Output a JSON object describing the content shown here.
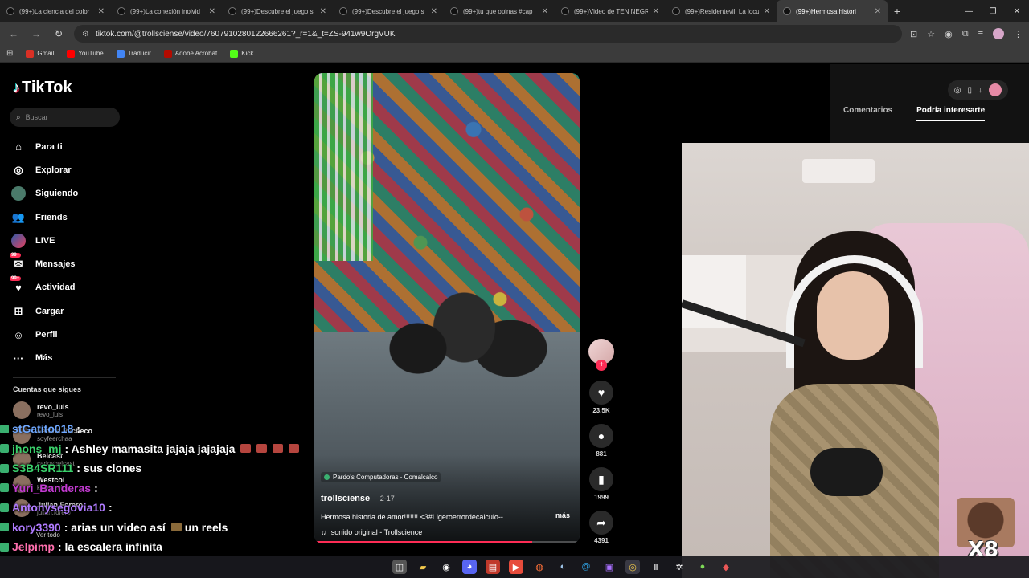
{
  "browser": {
    "tabs": [
      {
        "title": "(99+)La ciencia del color",
        "active": false
      },
      {
        "title": "(99+)La conexión inolvid",
        "active": false
      },
      {
        "title": "(99+)Descubre el juego s",
        "active": false
      },
      {
        "title": "(99+)Descubre el juego s",
        "active": false
      },
      {
        "title": "(99+)tu que opinas #cap",
        "active": false
      },
      {
        "title": "(99+)Video de TEN NEGR",
        "active": false
      },
      {
        "title": "(99+)Residentevil: La locu",
        "active": false
      },
      {
        "title": "(99+)Hermosa histori",
        "active": true
      }
    ],
    "address": "tiktok.com/@trollsciense/video/7607910280122666261?_r=1&_t=ZS-941w9OrgVUK",
    "bookmarks": [
      {
        "label": "Gmail",
        "color": "#d93025"
      },
      {
        "label": "YouTube",
        "color": "#ff0000"
      },
      {
        "label": "Traducir",
        "color": "#4285f4"
      },
      {
        "label": "Adobe Acrobat",
        "color": "#b30b00"
      },
      {
        "label": "Kick",
        "color": "#53fc18"
      }
    ]
  },
  "tiktok": {
    "logo": "TikTok",
    "search_placeholder": "Buscar",
    "nav": [
      {
        "label": "Para ti",
        "icon": "home-icon",
        "glyph": "⌂"
      },
      {
        "label": "Explorar",
        "icon": "compass-icon",
        "glyph": "◎"
      },
      {
        "label": "Siguiendo",
        "icon": "following-avatar-icon",
        "glyph": ""
      },
      {
        "label": "Friends",
        "icon": "friends-icon",
        "glyph": "👥"
      },
      {
        "label": "LIVE",
        "icon": "live-icon",
        "glyph": ""
      },
      {
        "label": "Mensajes",
        "icon": "messages-icon",
        "glyph": "✉",
        "badge": "99+"
      },
      {
        "label": "Actividad",
        "icon": "activity-icon",
        "glyph": "♥",
        "badge": "99+"
      },
      {
        "label": "Cargar",
        "icon": "upload-icon",
        "glyph": "⊞"
      },
      {
        "label": "Perfil",
        "icon": "profile-icon",
        "glyph": "☺"
      },
      {
        "label": "Más",
        "icon": "more-icon",
        "glyph": "···"
      }
    ],
    "following_header": "Cuentas que sigues",
    "accounts": [
      {
        "name": "revo_luis",
        "handle": "revo_luis"
      },
      {
        "name": "Fercha Pacheco",
        "handle": "soyfeerchaa"
      },
      {
        "name": "Belcast",
        "handle": "carlosbelcast"
      },
      {
        "name": "Westcol",
        "handle": "karloskol"
      },
      {
        "name": "Julian Forero",
        "handle": "julian.forero"
      }
    ],
    "see_all": "Ver todo"
  },
  "chat": [
    {
      "user": "stGatito018",
      "msg": " :",
      "color": "#6fa8ff"
    },
    {
      "user": "jhons_mj",
      "msg": " : Ashley mamasita jajaja jajajaja",
      "color": "#3ad16b"
    },
    {
      "user": "S3B4SR111",
      "msg": " : sus clones",
      "color": "#3ad16b"
    },
    {
      "user": "Yuri_Banderas",
      "msg": " :",
      "color": "#c23ad1"
    },
    {
      "user": "Antonysegovia10",
      "msg": " :",
      "color": "#b07bff"
    },
    {
      "user": "kory3390",
      "msg": " : arias un video así",
      "color": "#b07bff",
      "tail": "un reels"
    },
    {
      "user": "Jelpimp",
      "msg": " : la escalera infinita",
      "color": "#ff6fae"
    }
  ],
  "video": {
    "location": "Pardo's Computadoras - Comalcalco",
    "author": "trollsciense",
    "date": "2-17",
    "description": "Hermosa historia de amor!!!!!!! <3#Ligeroerrordecalculo--",
    "more": "más",
    "sound": "sonido original - Trollscience",
    "progress": 0.82,
    "likes": "23.5K",
    "comments": "881",
    "saves": "1999",
    "shares": "4391"
  },
  "right_panel": {
    "tabs": [
      "Comentarios",
      "Podría interesarte"
    ],
    "active_tab": 1
  },
  "overlay": {
    "multiplier": "X8"
  }
}
